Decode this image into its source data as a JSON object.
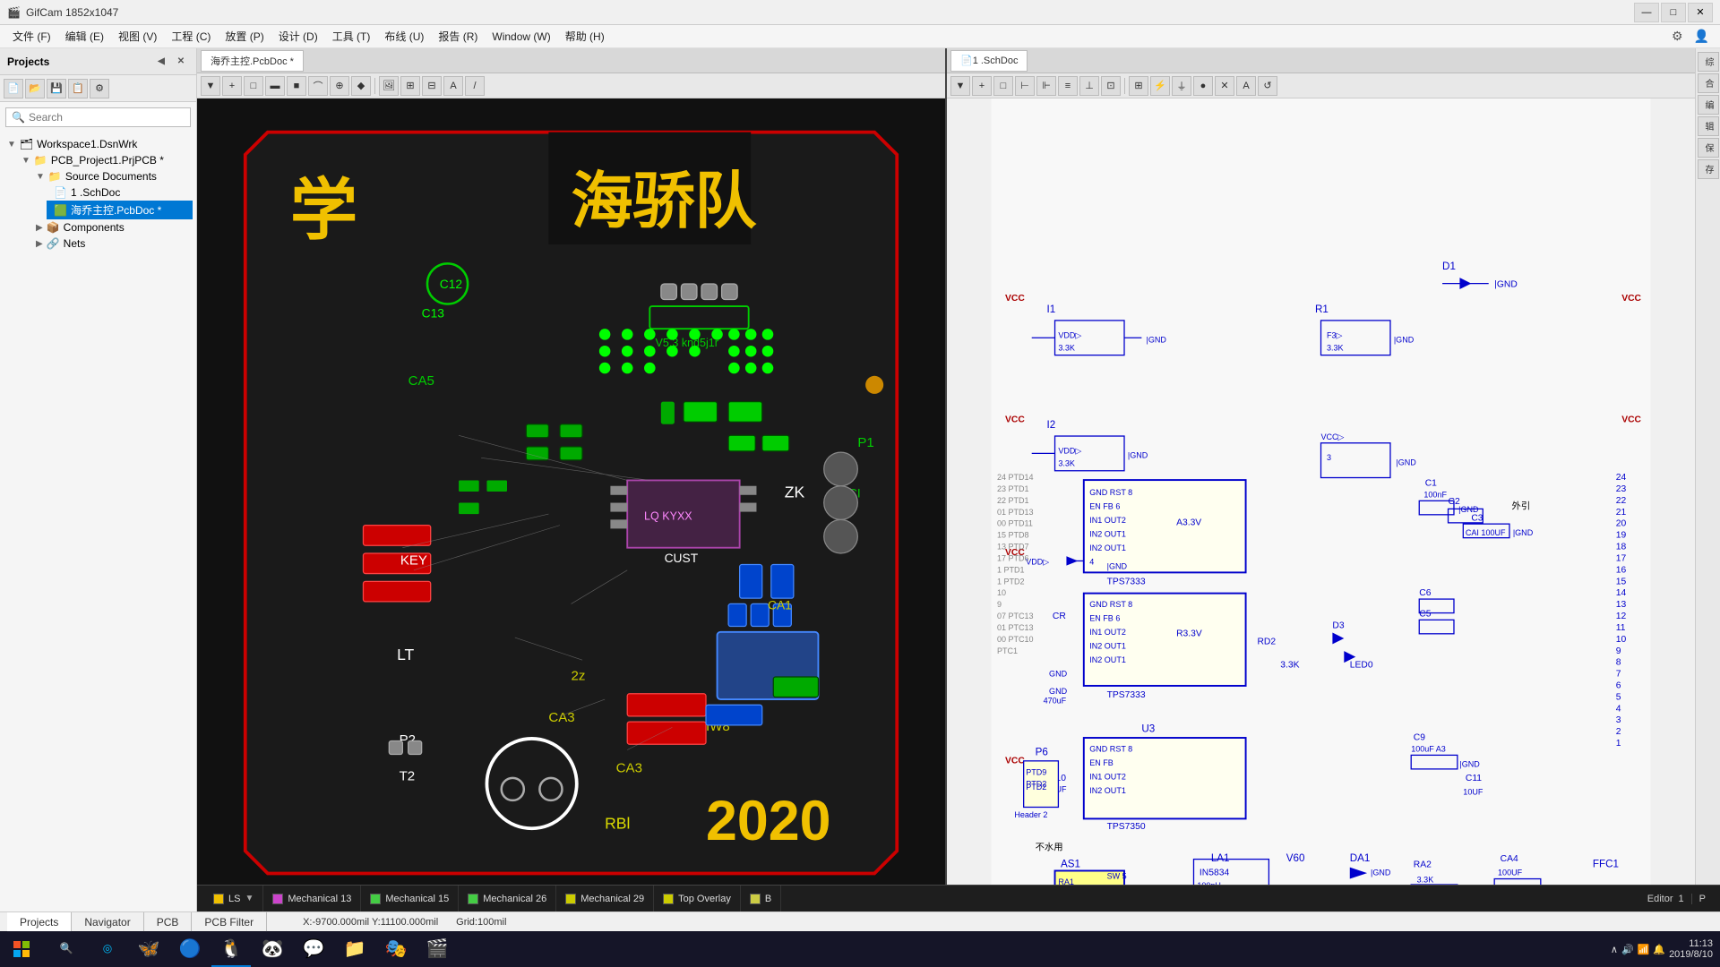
{
  "titlebar": {
    "title": "GifCam 1852x1047",
    "icon": "🎬",
    "controls": [
      "—",
      "□",
      "✕"
    ]
  },
  "menubar": {
    "items": [
      "文件 (F)",
      "编辑 (E)",
      "视图 (V)",
      "工程 (C)",
      "放置 (P)",
      "设计 (D)",
      "工具 (T)",
      "布线 (U)",
      "报告 (R)",
      "Window (W)",
      "帮助 (H)"
    ]
  },
  "sidebar": {
    "title": "Projects",
    "search_placeholder": "Search",
    "tree": {
      "workspace": "Workspace1.DsnWrk",
      "project": "PCB_Project1.PrjPCB *",
      "source_docs": "Source Documents",
      "schematic": "1 .SchDoc",
      "pcb": "海乔主控.PcbDoc *",
      "components": "Components",
      "nets": "Nets"
    }
  },
  "tabs": {
    "pcb_tab": "海乔主控.PcbDoc *",
    "sch_tab": "1 .SchDoc"
  },
  "pcb": {
    "title_text": "海骄队",
    "subtitle_text": "学",
    "year_text": "2020",
    "board_color": "#1a1a1a"
  },
  "layer_tabs": [
    {
      "label": "LS",
      "color": "#f0c000"
    },
    {
      "label": "Mechanical 13",
      "color": "#cc44cc"
    },
    {
      "label": "Mechanical 15",
      "color": "#44cc44"
    },
    {
      "label": "Mechanical 26",
      "color": "#44cc44"
    },
    {
      "label": "Mechanical 29",
      "color": "#cccc00"
    },
    {
      "label": "Top Overlay",
      "color": "#cccc00"
    },
    {
      "label": "B",
      "color": "#cccc44"
    }
  ],
  "status_bar": {
    "coords": "X:-9700.000mil Y:11100.000mil",
    "grid": "Grid:100mil"
  },
  "bottom_tabs": {
    "items": [
      "Projects",
      "Navigator",
      "PCB",
      "PCB Filter"
    ]
  },
  "taskbar": {
    "time": "11:13",
    "date": "2019/8/10"
  },
  "right_strip": {
    "items": [
      "综",
      "合",
      "编",
      "辑",
      "保",
      "存"
    ]
  },
  "editor_tab": "Editor",
  "editor_num": "1",
  "p_indicator": "P"
}
